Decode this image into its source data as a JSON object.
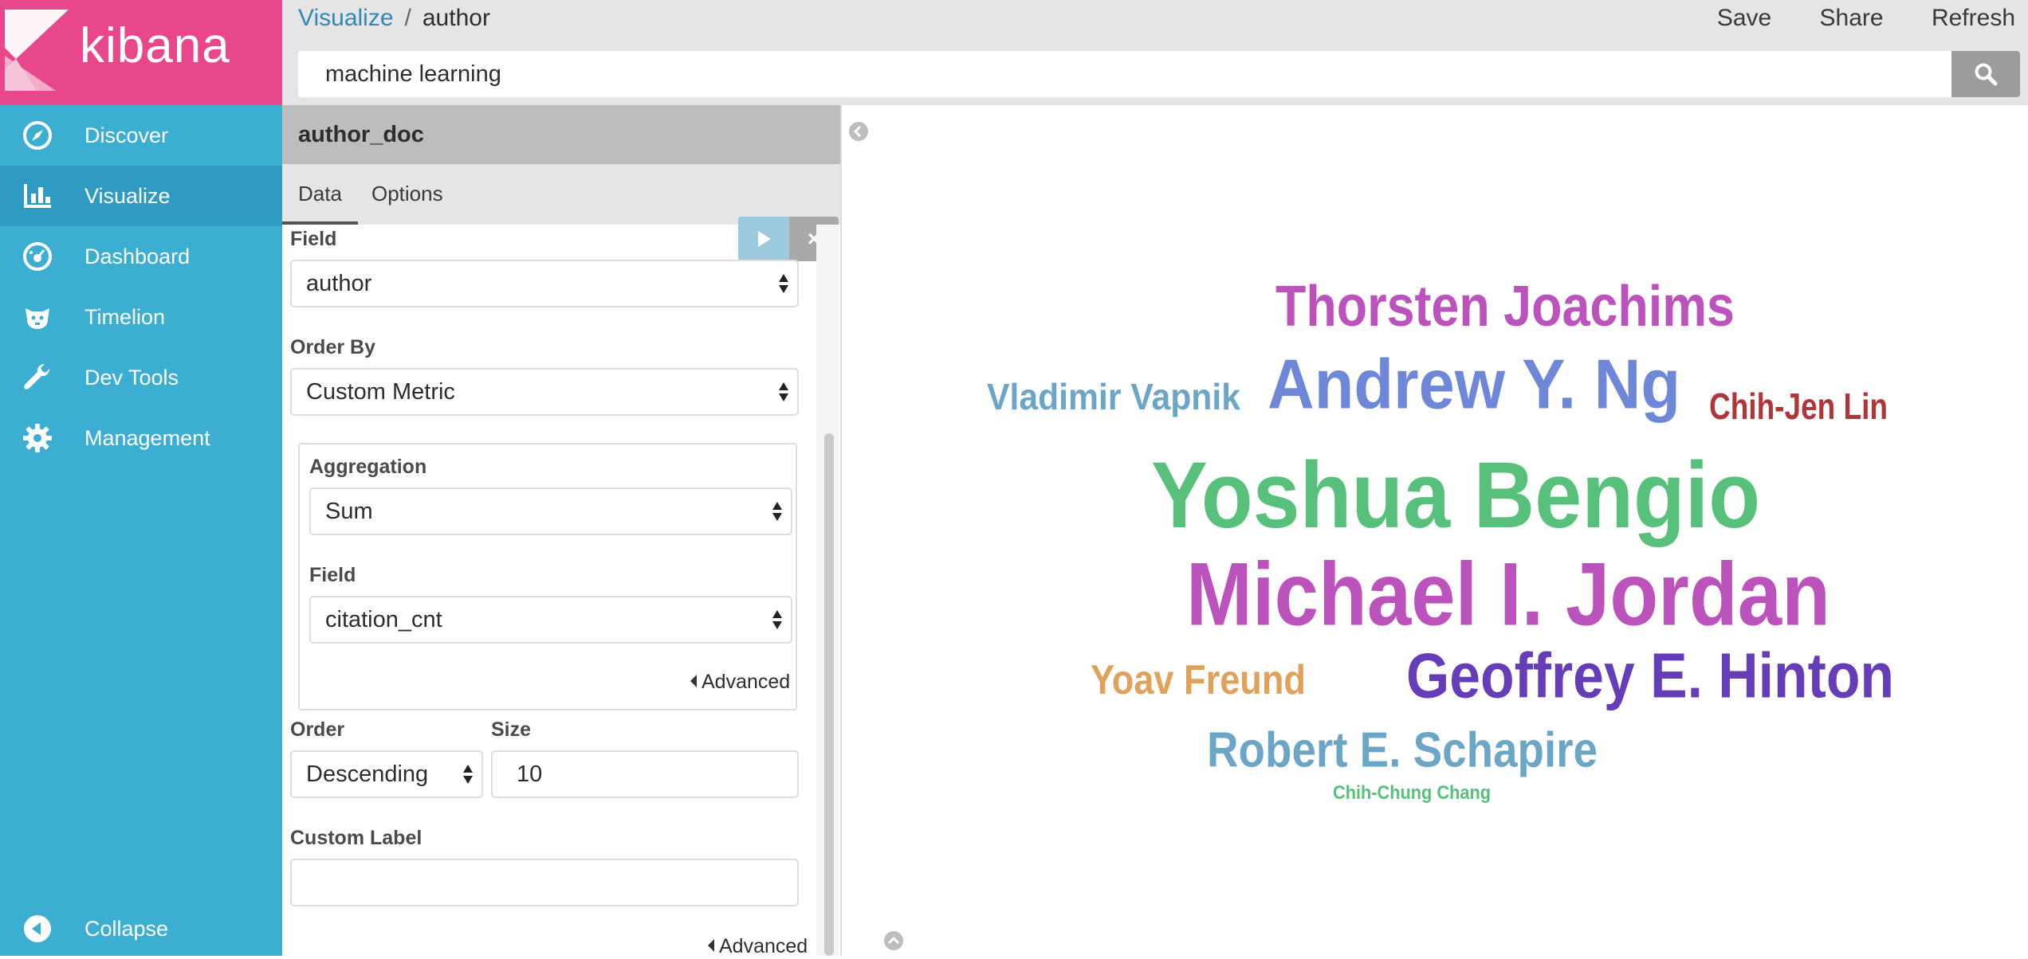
{
  "nav": {
    "logo_text": "kibana",
    "items": [
      {
        "label": "Discover",
        "icon": "compass-icon"
      },
      {
        "label": "Visualize",
        "icon": "bar-chart-icon"
      },
      {
        "label": "Dashboard",
        "icon": "dashboard-icon"
      },
      {
        "label": "Timelion",
        "icon": "timelion-icon"
      },
      {
        "label": "Dev Tools",
        "icon": "wrench-icon"
      },
      {
        "label": "Management",
        "icon": "gear-icon"
      }
    ],
    "collapse_label": "Collapse"
  },
  "breadcrumb": {
    "root": "Visualize",
    "separator": "/",
    "current": "author"
  },
  "actions": {
    "save": "Save",
    "share": "Share",
    "refresh": "Refresh"
  },
  "search": {
    "value": "machine learning"
  },
  "editor": {
    "index_pattern": "author_doc",
    "tabs": [
      "Data",
      "Options"
    ],
    "discard_symbol": "×",
    "field_label": "Field",
    "field_value": "author",
    "order_by_label": "Order By",
    "order_by_value": "Custom Metric",
    "aggregation_label": "Aggregation",
    "aggregation_value": "Sum",
    "agg_field_label": "Field",
    "agg_field_value": "citation_cnt",
    "advanced_label": "Advanced",
    "order_label": "Order",
    "order_value": "Descending",
    "size_label": "Size",
    "size_value": "10",
    "custom_label_label": "Custom Label",
    "custom_label_value": "",
    "advanced_label_2": "Advanced"
  },
  "colors": {
    "nav_bg": "#3caed2",
    "logo_bg": "#e8488b",
    "link": "#3188b6"
  },
  "chart_data": {
    "type": "tag_cloud",
    "tags": [
      {
        "text": "Yoshua Bengio",
        "color": "#57c17b"
      },
      {
        "text": "Michael I. Jordan",
        "color": "#bc52bc"
      },
      {
        "text": "Andrew Y. Ng",
        "color": "#6f87d8"
      },
      {
        "text": "Geoffrey E. Hinton",
        "color": "#663db8"
      },
      {
        "text": "Thorsten Joachims",
        "color": "#bc52bc"
      },
      {
        "text": "Robert E. Schapire",
        "color": "#6ba6c6"
      },
      {
        "text": "Vladimir Vapnik",
        "color": "#6ba6c6"
      },
      {
        "text": "Chih-Jen Lin",
        "color": "#b0363a"
      },
      {
        "text": "Yoav Freund",
        "color": "#e0a25a"
      },
      {
        "text": "Chih-Chung Chang",
        "color": "#57c17b"
      }
    ]
  }
}
